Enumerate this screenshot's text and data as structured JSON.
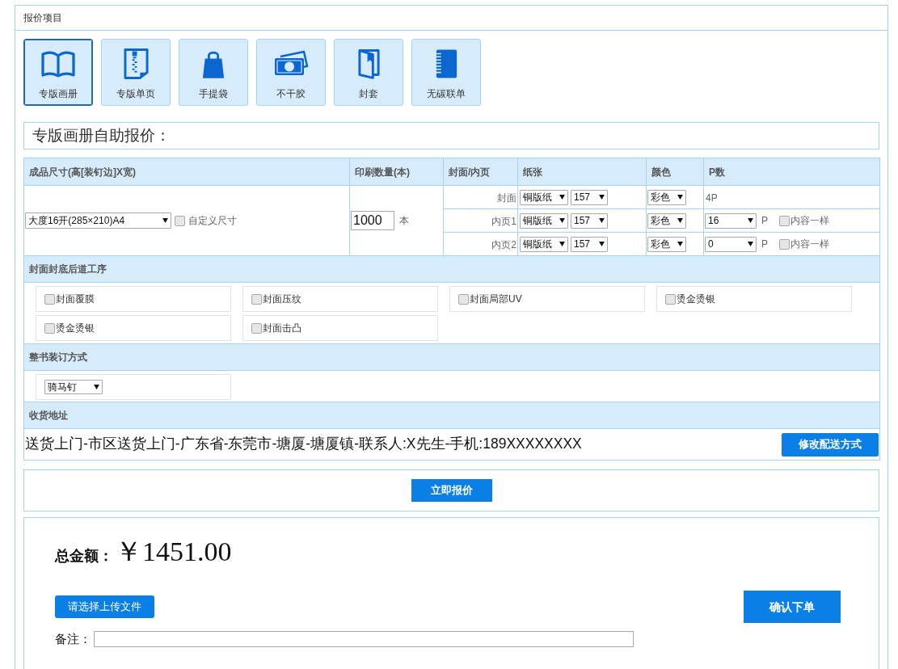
{
  "panel": {
    "title": "报价项目"
  },
  "products": [
    {
      "label": "专版画册",
      "selected": true
    },
    {
      "label": "专版单页",
      "selected": false
    },
    {
      "label": "手提袋",
      "selected": false
    },
    {
      "label": "不干胶",
      "selected": false
    },
    {
      "label": "封套",
      "selected": false
    },
    {
      "label": "无碳联单",
      "selected": false
    }
  ],
  "quote_title": "专版画册自助报价：",
  "spec_table": {
    "columns": [
      "成品尺寸(高[装钉边]X宽)",
      "印刷数量(本)",
      "封面/内页",
      "纸张",
      "颜色",
      "P数"
    ],
    "size": {
      "value": "大度16开(285×210)A4",
      "custom_label": "自定义尺寸",
      "custom_checked": false
    },
    "quantity": {
      "value": "1000",
      "unit": "本"
    },
    "parts": [
      {
        "name": "封面",
        "paper": "铜版纸",
        "weight": "157",
        "print_mode": "彩色",
        "pages": {
          "kind": "text",
          "text": "4P"
        }
      },
      {
        "name": "内页1",
        "paper": "铜版纸",
        "weight": "157",
        "print_mode": "彩色",
        "pages": {
          "kind": "select",
          "value": "16",
          "unit": "P",
          "same_label": "内容一样",
          "same_checked": false
        }
      },
      {
        "name": "内页2",
        "paper": "铜版纸",
        "weight": "157",
        "print_mode": "彩色",
        "pages": {
          "kind": "select",
          "value": "0",
          "unit": "P",
          "same_label": "内容一样",
          "same_checked": false
        }
      }
    ]
  },
  "finishing": {
    "title": "封面封底后道工序",
    "options": [
      {
        "label": "封面覆膜",
        "checked": false
      },
      {
        "label": "封面压纹",
        "checked": false
      },
      {
        "label": "封面局部UV",
        "checked": false
      },
      {
        "label": "烫金烫银",
        "checked": false
      },
      {
        "label": "烫金烫银",
        "checked": false
      },
      {
        "label": "封面击凸",
        "checked": false
      }
    ]
  },
  "binding": {
    "title": "整书装订方式",
    "value": "骑马钉"
  },
  "shipping": {
    "title": "收货地址",
    "address": "送货上门-市区送货上门-广东省-东莞市-塘厦-塘厦镇-联系人:X先生-手机:189XXXXXXXX",
    "button": "修改配送方式"
  },
  "quote_button": "立即报价",
  "summary": {
    "total_label": "总金额：",
    "total": "￥1451.00",
    "upload_button": "请选择上传文件",
    "confirm_button": "确认下单",
    "remark_label": "备注："
  }
}
